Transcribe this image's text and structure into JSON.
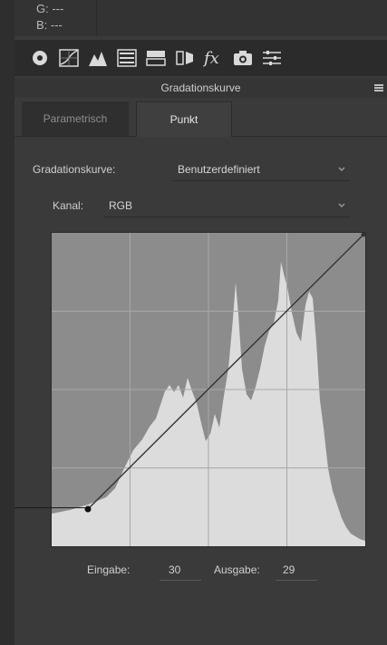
{
  "info": {
    "line1": "G: ---",
    "line2": "B: ---"
  },
  "toolbar": {
    "icons": [
      "basic-panel-icon",
      "tone-curve-icon",
      "detail-icon",
      "hsl-icon",
      "split-toning-icon",
      "lens-icon",
      "effects-icon",
      "camera-calibration-icon",
      "presets-icon"
    ]
  },
  "panel": {
    "title": "Gradationskurve"
  },
  "tabs": [
    {
      "label": "Parametrisch"
    },
    {
      "label": "Punkt"
    }
  ],
  "curve_preset": {
    "label": "Gradationskurve:",
    "value": "Benutzerdefiniert"
  },
  "channel": {
    "label": "Kanal:",
    "value": "RGB"
  },
  "input": {
    "label": "Eingabe:",
    "value": "30"
  },
  "output": {
    "label": "Ausgabe:",
    "value": "29"
  }
}
